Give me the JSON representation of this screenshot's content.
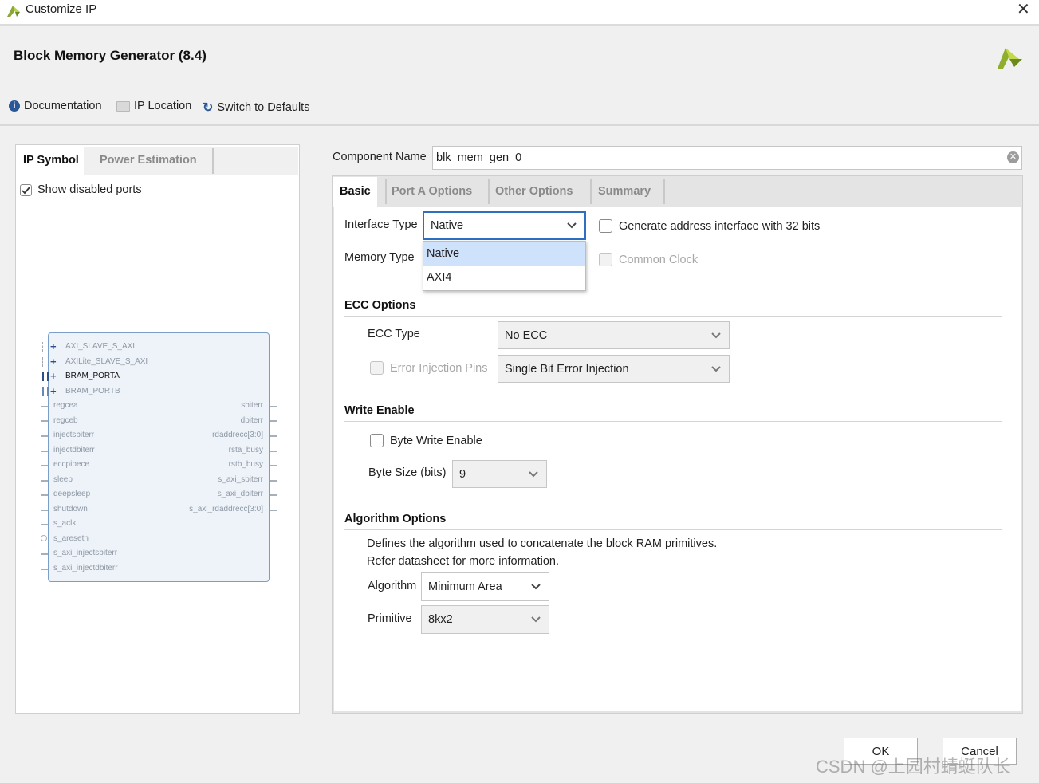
{
  "window": {
    "title": "Customize IP",
    "heading": "Block Memory Generator (8.4)"
  },
  "toolbar": {
    "documentation": "Documentation",
    "ip_location": "IP Location",
    "switch_defaults": "Switch to Defaults"
  },
  "left": {
    "tabs": [
      "IP Symbol",
      "Power Estimation"
    ],
    "show_disabled_ports": "Show disabled ports",
    "ports_left": [
      "AXI_SLAVE_S_AXI",
      "AXILite_SLAVE_S_AXI",
      "BRAM_PORTA",
      "BRAM_PORTB",
      "regcea",
      "regceb",
      "injectsbiterr",
      "injectdbiterr",
      "eccpipece",
      "sleep",
      "deepsleep",
      "shutdown",
      "s_aclk",
      "s_aresetn",
      "s_axi_injectsbiterr",
      "s_axi_injectdbiterr"
    ],
    "ports_right": [
      "sbiterr",
      "dbiterr",
      "rdaddrecc[3:0]",
      "rsta_busy",
      "rstb_busy",
      "s_axi_sbiterr",
      "s_axi_dbiterr",
      "s_axi_rdaddrecc[3:0]"
    ]
  },
  "component": {
    "label": "Component Name",
    "value": "blk_mem_gen_0"
  },
  "tabs": [
    "Basic",
    "Port A Options",
    "Other Options",
    "Summary"
  ],
  "basic": {
    "interface_type_label": "Interface Type",
    "interface_type_value": "Native",
    "interface_options": [
      "Native",
      "AXI4"
    ],
    "memory_type_label": "Memory Type",
    "gen_addr_32": "Generate address interface with 32 bits",
    "common_clock": "Common Clock",
    "ecc_section": "ECC Options",
    "ecc_type_label": "ECC Type",
    "ecc_type_value": "No ECC",
    "error_injection_label": "Error Injection Pins",
    "error_injection_value": "Single Bit Error Injection",
    "write_enable_section": "Write Enable",
    "byte_write_enable": "Byte Write Enable",
    "byte_size_label": "Byte Size (bits)",
    "byte_size_value": "9",
    "algorithm_section": "Algorithm Options",
    "algo_desc_1": "Defines the algorithm used to concatenate the block RAM primitives.",
    "algo_desc_2": "Refer datasheet for more information.",
    "algorithm_label": "Algorithm",
    "algorithm_value": "Minimum Area",
    "primitive_label": "Primitive",
    "primitive_value": "8kx2"
  },
  "buttons": {
    "ok": "OK",
    "cancel": "Cancel"
  },
  "watermark": "CSDN @上园村蜻蜓队长",
  "colors": {
    "accent": "#7fae2a",
    "selection": "#cfe2fb",
    "info": "#2b5797"
  }
}
